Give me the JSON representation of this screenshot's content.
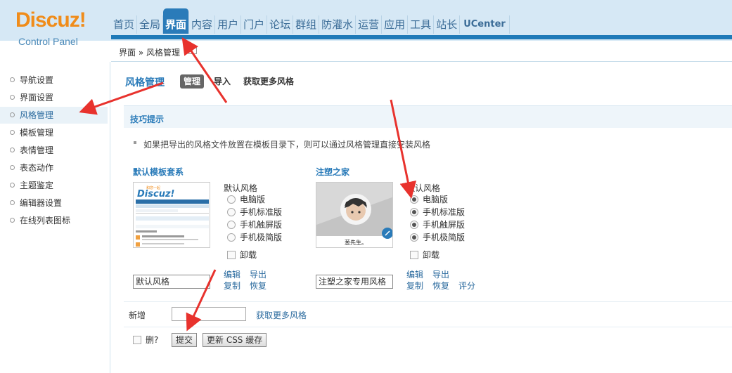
{
  "logo": {
    "word": "Discuz!",
    "sub": "Control Panel"
  },
  "nav": [
    "首页",
    "全局",
    "界面",
    "内容",
    "用户",
    "门户",
    "论坛",
    "群组",
    "防灌水",
    "运营",
    "应用",
    "工具",
    "站长",
    "UCenter"
  ],
  "breadcrumb": "界面 » 风格管理",
  "sidebar": [
    "导航设置",
    "界面设置",
    "风格管理",
    "模板管理",
    "表情管理",
    "表态动作",
    "主题鉴定",
    "编辑器设置",
    "在线列表图标"
  ],
  "page": {
    "title": "风格管理",
    "tabs": [
      "管理",
      "导入",
      "获取更多风格"
    ]
  },
  "tips": {
    "title": "技巧提示",
    "text": "如果把导出的风格文件放置在模板目录下，则可以通过风格管理直接安装风格"
  },
  "styles": [
    {
      "name": "默认模板套系",
      "default_label": "默认风格",
      "options": [
        "电脑版",
        "手机标准版",
        "手机触屏版",
        "手机极简版"
      ],
      "uninstall": "卸载",
      "input_value": "默认风格",
      "links": [
        "编辑",
        "导出",
        "复制",
        "恢复"
      ]
    },
    {
      "name": "注塑之家",
      "default_label": "默认风格",
      "options": [
        "电脑版",
        "手机标准版",
        "手机触屏版",
        "手机极简版"
      ],
      "uninstall": "卸载",
      "input_value": "注塑之家专用风格",
      "links": [
        "编辑",
        "导出",
        "复制",
        "恢复",
        "评分"
      ],
      "avatar_caption": "葱先生。"
    }
  ],
  "new_row": {
    "label": "新增",
    "link": "获取更多风格"
  },
  "footer": {
    "delete_label": "删?",
    "submit": "提交",
    "update_css": "更新 CSS 缓存"
  },
  "preview1": {
    "logo": "Discuz!",
    "tag": "和您一起"
  },
  "colors": {
    "accent": "#2a7bb9",
    "arrow": "#e8322d",
    "logo": "#f08c1a"
  }
}
